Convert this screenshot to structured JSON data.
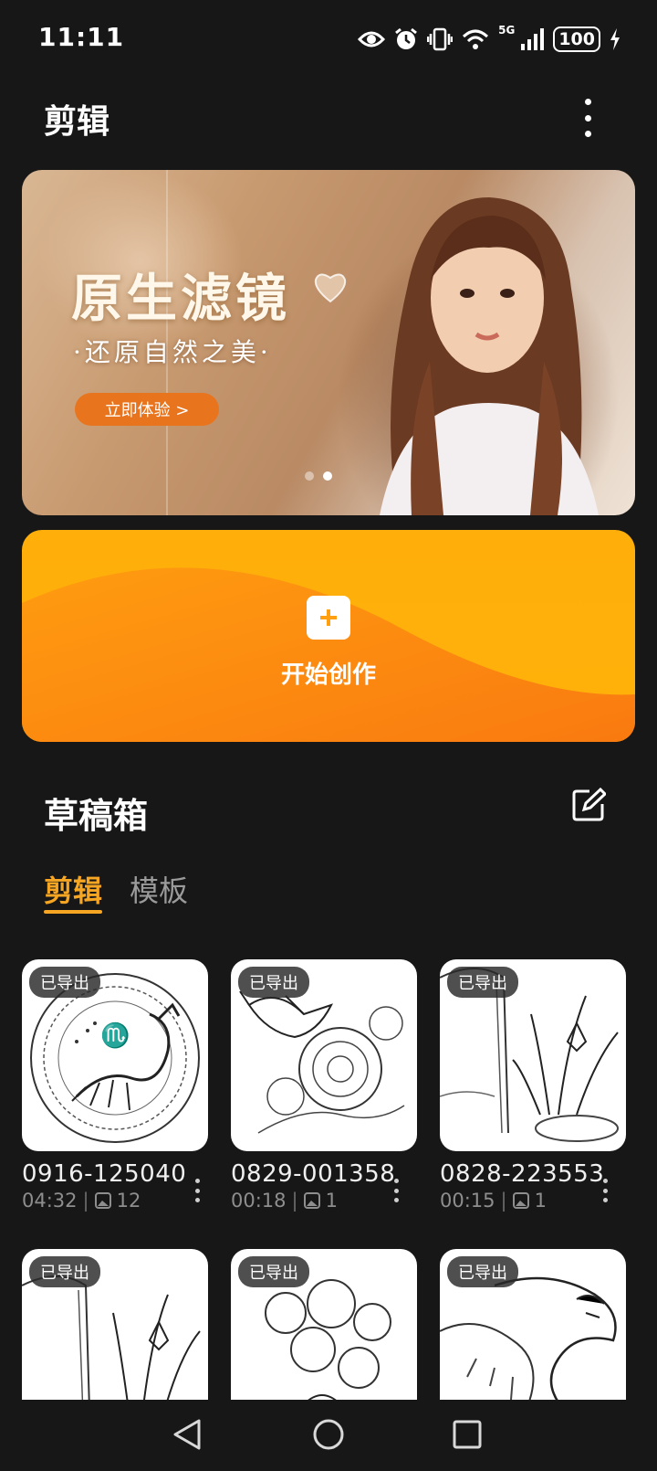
{
  "status_bar": {
    "time": "11:11",
    "network": "5G",
    "battery": "100",
    "icons": [
      "eye-icon",
      "alarm-icon",
      "vibrate-icon",
      "wifi-icon",
      "signal-icon",
      "battery-icon",
      "charging-icon"
    ]
  },
  "header": {
    "title": "剪辑",
    "menu_icon": "more-vertical-icon"
  },
  "banner": {
    "title": "原生滤镜",
    "subtitle": "·还原自然之美·",
    "button_label": "立即体验 >",
    "page_count": 2,
    "active_page": 2
  },
  "create": {
    "label": "开始创作",
    "icon": "plus-icon"
  },
  "drafts": {
    "title": "草稿箱",
    "edit_icon": "edit-icon",
    "tabs": [
      {
        "label": "剪辑",
        "active": true
      },
      {
        "label": "模板",
        "active": false
      }
    ],
    "items": [
      {
        "badge": "已导出",
        "name": "0916-125040",
        "duration": "04:32",
        "sep": "|",
        "count": "12",
        "art": "scorpio"
      },
      {
        "badge": "已导出",
        "name": "0829-001358",
        "duration": "00:18",
        "sep": "|",
        "count": "1",
        "art": "bird-flowers"
      },
      {
        "badge": "已导出",
        "name": "0828-223553",
        "duration": "00:15",
        "sep": "|",
        "count": "1",
        "art": "lily-water"
      },
      {
        "badge": "已导出",
        "art": "lily-water"
      },
      {
        "badge": "已导出",
        "art": "flower-bouquet"
      },
      {
        "badge": "已导出",
        "art": "dragon"
      }
    ]
  },
  "nav": {
    "icons": [
      "back-icon",
      "home-icon",
      "recents-icon"
    ]
  },
  "colors": {
    "background": "#171717",
    "accent": "#f6a623",
    "create_card": "#ffae0a",
    "banner_button": "#e8741e"
  }
}
